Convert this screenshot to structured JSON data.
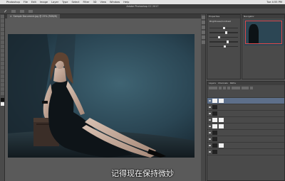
{
  "menubar": {
    "items": [
      "",
      "Photoshop",
      "File",
      "Edit",
      "Image",
      "Layer",
      "Type",
      "Select",
      "Filter",
      "3D",
      "View",
      "Window",
      "Help"
    ],
    "right": [
      "",
      "",
      "Tue 4:55 PM",
      ""
    ]
  },
  "window_title": "Adobe Photoshop CC 2017",
  "options": {
    "tool_label": "Brush",
    "field1": "",
    "field2": ""
  },
  "document": {
    "tab_label": "Sample Document.jpg @ 25% (RGB/8)",
    "close_glyph": "×"
  },
  "properties": {
    "tabs": [
      "Properties",
      "Adjustments"
    ],
    "title": "Brightness/Contrast"
  },
  "navigator": {
    "tabs": [
      "Navigator",
      "Histogram"
    ]
  },
  "layers": {
    "tabs": [
      "Layers",
      "Channels",
      "Paths"
    ],
    "rows": [
      {
        "name": "",
        "thumb": "white",
        "selected": true
      },
      {
        "name": "",
        "thumb": "dark",
        "selected": false
      },
      {
        "name": "",
        "thumb": "dark",
        "selected": false
      },
      {
        "name": "",
        "thumb": "white",
        "selected": false
      },
      {
        "name": "",
        "thumb": "white",
        "selected": false
      },
      {
        "name": "",
        "thumb": "dark",
        "selected": false
      },
      {
        "name": "",
        "thumb": "dark",
        "selected": false
      },
      {
        "name": "",
        "thumb": "dark",
        "selected": false
      },
      {
        "name": "",
        "thumb": "dark",
        "selected": false
      }
    ]
  },
  "subtitle": "记得现在保持微妙",
  "colors": {
    "accent_selected": "#5d6f8a",
    "canvas_bg": "#5a5a5a"
  }
}
